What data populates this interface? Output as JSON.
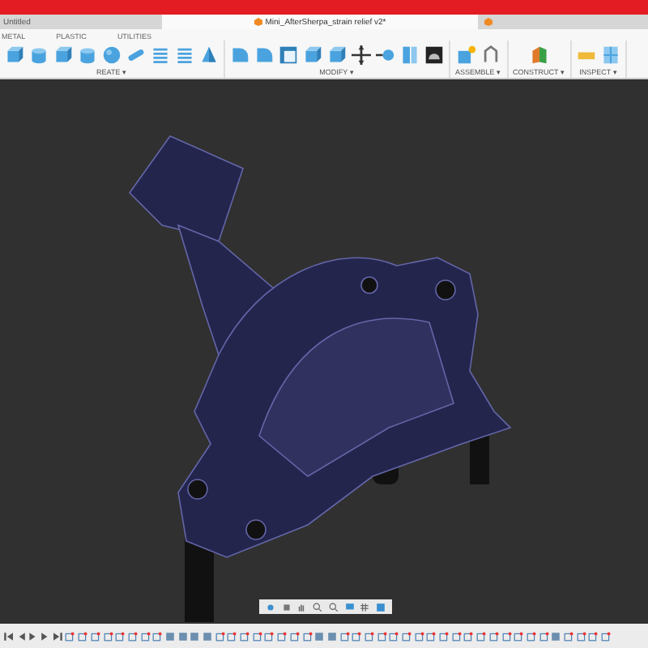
{
  "tabs": [
    {
      "label": "Untitled",
      "selected": false
    },
    {
      "label": "Mini_AfterSherpa_strain relief v2*",
      "selected": true
    },
    {
      "selected": false
    }
  ],
  "workspace_tabs": [
    {
      "label": "METAL",
      "selected": false
    },
    {
      "label": "PLASTIC",
      "selected": false
    },
    {
      "label": "UTILITIES",
      "selected": false
    }
  ],
  "toolbar_groups": [
    {
      "label": "REATE ▾"
    },
    {
      "label": "MODIFY ▾"
    },
    {
      "label": "ASSEMBLE ▾"
    },
    {
      "label": "CONSTRUCT ▾"
    },
    {
      "label": "INSPECT ▾"
    }
  ]
}
